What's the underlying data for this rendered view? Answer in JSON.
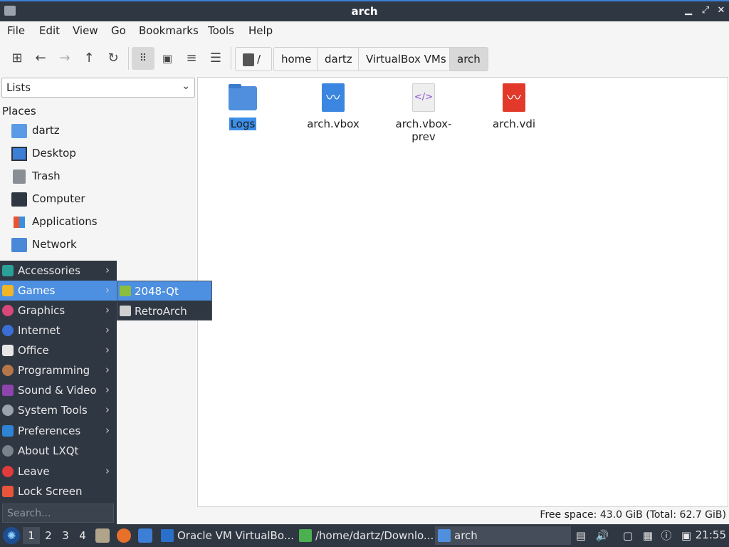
{
  "window": {
    "title": "arch"
  },
  "menubar": [
    "File",
    "Edit",
    "View",
    "Go",
    "Bookmarks",
    "Tools",
    "Help"
  ],
  "breadcrumbs": [
    "/",
    "home",
    "dartz",
    "VirtualBox VMs",
    "arch"
  ],
  "side_pane": {
    "mode": "Lists",
    "header": "Places",
    "places": [
      {
        "label": "dartz",
        "icon": "home-folder-icon"
      },
      {
        "label": "Desktop",
        "icon": "desktop-icon"
      },
      {
        "label": "Trash",
        "icon": "trash-icon"
      },
      {
        "label": "Computer",
        "icon": "computer-icon"
      },
      {
        "label": "Applications",
        "icon": "applications-icon"
      },
      {
        "label": "Network",
        "icon": "network-icon"
      }
    ]
  },
  "files": [
    {
      "name": "Logs",
      "icon": "folder-icon",
      "selected": true
    },
    {
      "name": "arch.vbox",
      "icon": "vbox-file-icon"
    },
    {
      "name": "arch.vbox-prev",
      "icon": "xml-file-icon"
    },
    {
      "name": "arch.vdi",
      "icon": "vdi-file-icon"
    }
  ],
  "status": {
    "free_space": "Free space: 43.0 GiB (Total: 62.7 GiB)"
  },
  "start_menu": {
    "items": [
      {
        "label": "Accessories",
        "has_submenu": true
      },
      {
        "label": "Games",
        "has_submenu": true,
        "highlighted": true
      },
      {
        "label": "Graphics",
        "has_submenu": true
      },
      {
        "label": "Internet",
        "has_submenu": true
      },
      {
        "label": "Office",
        "has_submenu": true
      },
      {
        "label": "Programming",
        "has_submenu": true
      },
      {
        "label": "Sound & Video",
        "has_submenu": true
      },
      {
        "label": "System Tools",
        "has_submenu": true
      },
      {
        "label": "Preferences",
        "has_submenu": true
      },
      {
        "label": "About LXQt",
        "has_submenu": false
      },
      {
        "label": "Leave",
        "has_submenu": true
      },
      {
        "label": "Lock Screen",
        "has_submenu": false
      }
    ],
    "search_placeholder": "Search...",
    "submenu_games": [
      {
        "label": "2048-Qt",
        "highlighted": true
      },
      {
        "label": "RetroArch"
      }
    ]
  },
  "taskbar": {
    "desktops": [
      "1",
      "2",
      "3",
      "4"
    ],
    "tasks": [
      {
        "label": "Oracle VM VirtualBo..."
      },
      {
        "label": "/home/dartz/Downlo..."
      },
      {
        "label": "arch",
        "active": true
      }
    ],
    "clock": "21:55"
  },
  "colors": {
    "accent": "#3d8ee8",
    "panel": "#2f3742"
  }
}
